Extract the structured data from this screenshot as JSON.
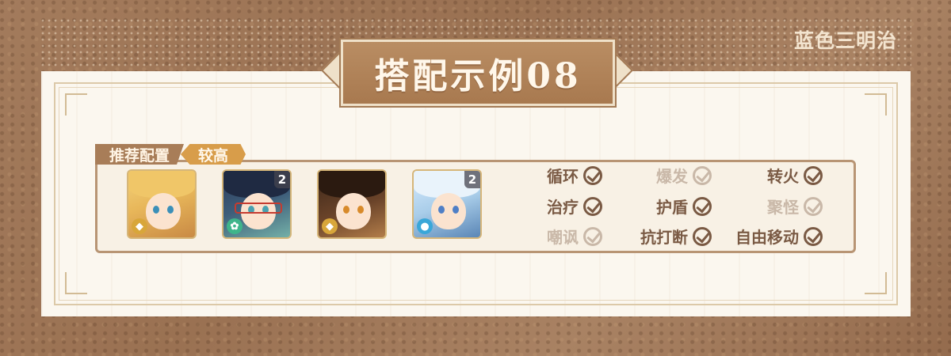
{
  "header": {
    "corner_label": "蓝色三明治",
    "title": "搭配示例08"
  },
  "tags": {
    "recommended": "推荐配置",
    "level": "较高"
  },
  "team": [
    {
      "name": "character-1",
      "constellation": "",
      "element": "geo"
    },
    {
      "name": "character-2",
      "constellation": "2",
      "element": "anemo"
    },
    {
      "name": "character-3",
      "constellation": "",
      "element": "geo"
    },
    {
      "name": "character-4",
      "constellation": "2",
      "element": "hydro"
    }
  ],
  "traits": [
    {
      "label": "循环",
      "active": true
    },
    {
      "label": "爆发",
      "active": false
    },
    {
      "label": "转火",
      "active": true
    },
    {
      "label": "治疗",
      "active": true
    },
    {
      "label": "护盾",
      "active": true
    },
    {
      "label": "聚怪",
      "active": false
    },
    {
      "label": "嘲讽",
      "active": false
    },
    {
      "label": "抗打断",
      "active": true
    },
    {
      "label": "自由移动",
      "active": true
    }
  ],
  "colors": {
    "active": "#7a5a44",
    "inactive": "#c9b8a8",
    "accent": "#d89d4a",
    "banner": "#b0835a"
  }
}
